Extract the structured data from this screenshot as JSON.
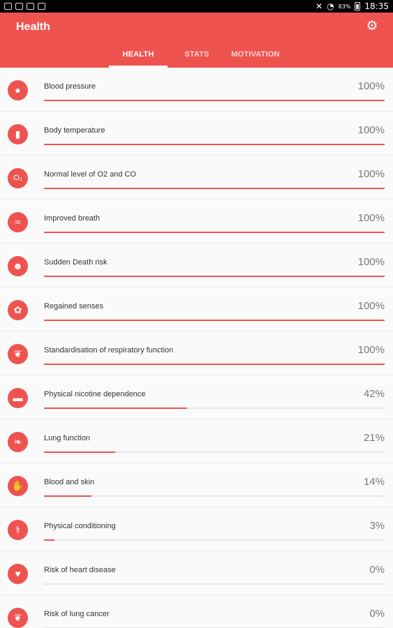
{
  "status_bar": {
    "time": "18:35",
    "battery": "83%"
  },
  "app_bar": {
    "title": "Health",
    "settings_icon": "gear-icon"
  },
  "tabs": [
    {
      "label": "HEALTH",
      "active": true
    },
    {
      "label": "STATS",
      "active": false
    },
    {
      "label": "MOTIVATION",
      "active": false
    }
  ],
  "items": [
    {
      "label": "Blood pressure",
      "value": "100%",
      "progress": 100,
      "icon": "drop-icon"
    },
    {
      "label": "Body temperature",
      "value": "100%",
      "progress": 100,
      "icon": "thermometer-icon"
    },
    {
      "label": "Normal level of O2 and CO",
      "value": "100%",
      "progress": 100,
      "icon": "o2-icon"
    },
    {
      "label": "Improved breath",
      "value": "100%",
      "progress": 100,
      "icon": "breath-icon"
    },
    {
      "label": "Sudden Death risk",
      "value": "100%",
      "progress": 100,
      "icon": "skull-icon"
    },
    {
      "label": "Regained senses",
      "value": "100%",
      "progress": 100,
      "icon": "flower-icon"
    },
    {
      "label": "Standardisation of respiratory function",
      "value": "100%",
      "progress": 100,
      "icon": "lungs-icon"
    },
    {
      "label": "Physical nicotine dependence",
      "value": "42%",
      "progress": 42,
      "icon": "cigarette-icon"
    },
    {
      "label": "Lung function",
      "value": "21%",
      "progress": 21,
      "icon": "lung-icon"
    },
    {
      "label": "Blood and skin",
      "value": "14%",
      "progress": 14,
      "icon": "hand-icon"
    },
    {
      "label": "Physical conditioning",
      "value": "3%",
      "progress": 3,
      "icon": "caduceus-icon"
    },
    {
      "label": "Risk of heart disease",
      "value": "0%",
      "progress": 0,
      "icon": "heart-icon"
    },
    {
      "label": "Risk of lung cancer",
      "value": "0%",
      "progress": 0,
      "icon": "lungs-icon"
    }
  ],
  "colors": {
    "accent": "#ef5350",
    "track": "#e6e6e6"
  }
}
